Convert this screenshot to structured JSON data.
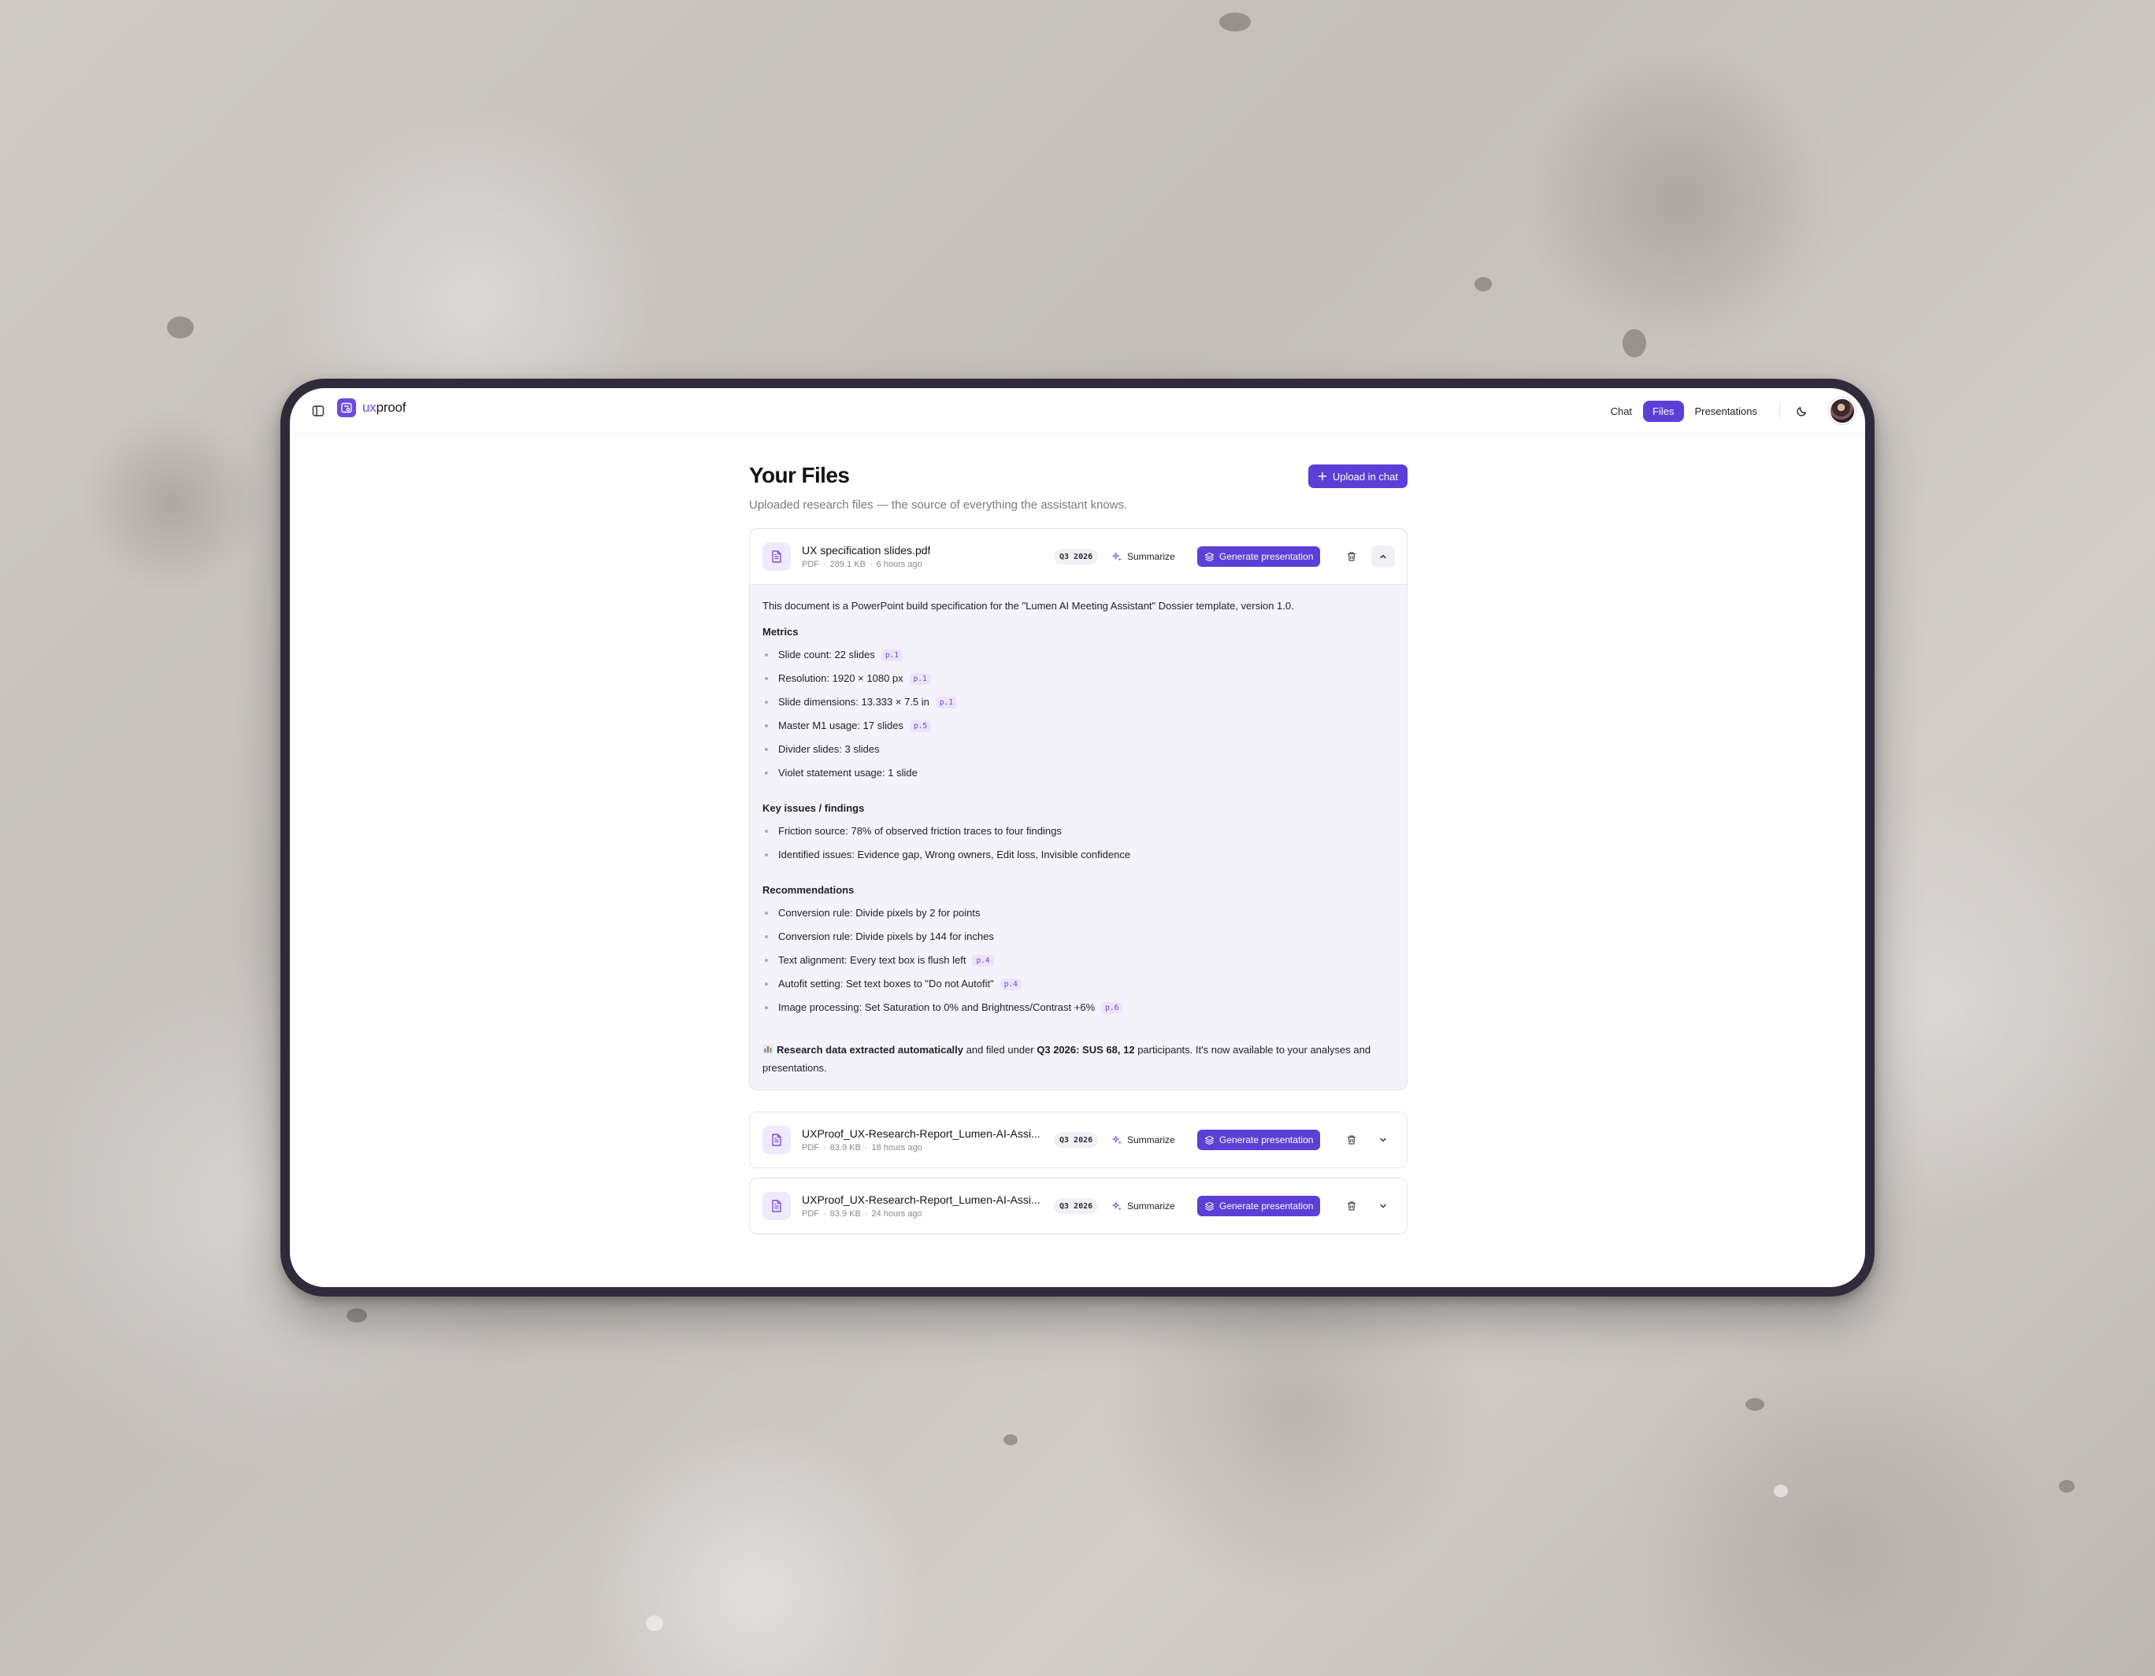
{
  "app": {
    "logo_prefix": "ux",
    "logo_suffix": "proof"
  },
  "nav": {
    "chat": "Chat",
    "files": "Files",
    "presentations": "Presentations"
  },
  "page": {
    "title": "Your Files",
    "subtitle": "Uploaded research files — the source of everything the assistant knows.",
    "upload_label": "Upload in chat"
  },
  "actions": {
    "summarize": "Summarize",
    "generate": "Generate presentation"
  },
  "files": [
    {
      "name": "UX specification slides.pdf",
      "type": "PDF",
      "size": "289.1 KB",
      "age": "6 hours ago",
      "badge": "Q3 2026"
    },
    {
      "name": "UXProof_UX-Research-Report_Lumen-AI-Assi...",
      "type": "PDF",
      "size": "83.9 KB",
      "age": "18 hours ago",
      "badge": "Q3 2026"
    },
    {
      "name": "UXProof_UX-Research-Report_Lumen-AI-Assi...",
      "type": "PDF",
      "size": "83.9 KB",
      "age": "24 hours ago",
      "badge": "Q3 2026"
    }
  ],
  "summary": {
    "intro": "This document is a PowerPoint build specification for the \"Lumen AI Meeting Assistant\" Dossier template, version 1.0.",
    "metrics_title": "Metrics",
    "metrics": [
      {
        "text": "Slide count: 22 slides",
        "ref": "p.1"
      },
      {
        "text": "Resolution: 1920 × 1080 px",
        "ref": "p.1"
      },
      {
        "text": "Slide dimensions: 13.333 × 7.5 in",
        "ref": "p.1"
      },
      {
        "text": "Master M1 usage: 17 slides",
        "ref": "p.5"
      },
      {
        "text": "Divider slides: 3 slides",
        "ref": ""
      },
      {
        "text": "Violet statement usage: 1 slide",
        "ref": ""
      }
    ],
    "issues_title": "Key issues / findings",
    "issues": [
      {
        "text": "Friction source: 78% of observed friction traces to four findings",
        "ref": ""
      },
      {
        "text": "Identified issues: Evidence gap, Wrong owners, Edit loss, Invisible confidence",
        "ref": ""
      }
    ],
    "recs_title": "Recommendations",
    "recs": [
      {
        "text": "Conversion rule: Divide pixels by 2 for points",
        "ref": ""
      },
      {
        "text": "Conversion rule: Divide pixels by 144 for inches",
        "ref": ""
      },
      {
        "text": "Text alignment: Every text box is flush left",
        "ref": "p.4"
      },
      {
        "text": "Autofit setting: Set text boxes to \"Do not Autofit\"",
        "ref": "p.4"
      },
      {
        "text": "Image processing: Set Saturation to 0% and Brightness/Contrast +6%",
        "ref": "p.6"
      }
    ],
    "research_bold": "Research data extracted automatically",
    "research_mid": " and filed under ",
    "research_period": "Q3 2026",
    "research_after_period": ": SUS ",
    "research_sus": "68",
    "research_comma": ", ",
    "research_participants": "12",
    "research_tail": " participants. It's now available to your analyses and presentations."
  },
  "colors": {
    "accent": "#5b3fd6",
    "ref_bg": "#ebe4fd",
    "ref_text": "#6a45d8"
  },
  "icons": [
    "sidebar-toggle-icon",
    "logo-icon",
    "moon-icon",
    "plus-icon",
    "file-icon",
    "sparkle-icon",
    "layers-icon",
    "trash-icon",
    "chevron-up-icon",
    "chevron-down-icon",
    "bar-chart-icon"
  ]
}
